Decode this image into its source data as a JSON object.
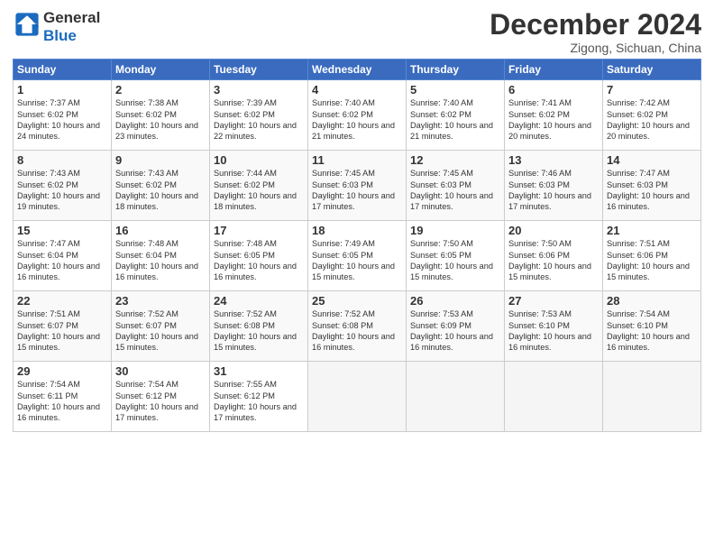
{
  "header": {
    "logo_general": "General",
    "logo_blue": "Blue",
    "month_title": "December 2024",
    "location": "Zigong, Sichuan, China"
  },
  "columns": [
    "Sunday",
    "Monday",
    "Tuesday",
    "Wednesday",
    "Thursday",
    "Friday",
    "Saturday"
  ],
  "weeks": [
    [
      {
        "day": "1",
        "sunrise": "Sunrise: 7:37 AM",
        "sunset": "Sunset: 6:02 PM",
        "daylight": "Daylight: 10 hours and 24 minutes."
      },
      {
        "day": "2",
        "sunrise": "Sunrise: 7:38 AM",
        "sunset": "Sunset: 6:02 PM",
        "daylight": "Daylight: 10 hours and 23 minutes."
      },
      {
        "day": "3",
        "sunrise": "Sunrise: 7:39 AM",
        "sunset": "Sunset: 6:02 PM",
        "daylight": "Daylight: 10 hours and 22 minutes."
      },
      {
        "day": "4",
        "sunrise": "Sunrise: 7:40 AM",
        "sunset": "Sunset: 6:02 PM",
        "daylight": "Daylight: 10 hours and 21 minutes."
      },
      {
        "day": "5",
        "sunrise": "Sunrise: 7:40 AM",
        "sunset": "Sunset: 6:02 PM",
        "daylight": "Daylight: 10 hours and 21 minutes."
      },
      {
        "day": "6",
        "sunrise": "Sunrise: 7:41 AM",
        "sunset": "Sunset: 6:02 PM",
        "daylight": "Daylight: 10 hours and 20 minutes."
      },
      {
        "day": "7",
        "sunrise": "Sunrise: 7:42 AM",
        "sunset": "Sunset: 6:02 PM",
        "daylight": "Daylight: 10 hours and 20 minutes."
      }
    ],
    [
      {
        "day": "8",
        "sunrise": "Sunrise: 7:43 AM",
        "sunset": "Sunset: 6:02 PM",
        "daylight": "Daylight: 10 hours and 19 minutes."
      },
      {
        "day": "9",
        "sunrise": "Sunrise: 7:43 AM",
        "sunset": "Sunset: 6:02 PM",
        "daylight": "Daylight: 10 hours and 18 minutes."
      },
      {
        "day": "10",
        "sunrise": "Sunrise: 7:44 AM",
        "sunset": "Sunset: 6:02 PM",
        "daylight": "Daylight: 10 hours and 18 minutes."
      },
      {
        "day": "11",
        "sunrise": "Sunrise: 7:45 AM",
        "sunset": "Sunset: 6:03 PM",
        "daylight": "Daylight: 10 hours and 17 minutes."
      },
      {
        "day": "12",
        "sunrise": "Sunrise: 7:45 AM",
        "sunset": "Sunset: 6:03 PM",
        "daylight": "Daylight: 10 hours and 17 minutes."
      },
      {
        "day": "13",
        "sunrise": "Sunrise: 7:46 AM",
        "sunset": "Sunset: 6:03 PM",
        "daylight": "Daylight: 10 hours and 17 minutes."
      },
      {
        "day": "14",
        "sunrise": "Sunrise: 7:47 AM",
        "sunset": "Sunset: 6:03 PM",
        "daylight": "Daylight: 10 hours and 16 minutes."
      }
    ],
    [
      {
        "day": "15",
        "sunrise": "Sunrise: 7:47 AM",
        "sunset": "Sunset: 6:04 PM",
        "daylight": "Daylight: 10 hours and 16 minutes."
      },
      {
        "day": "16",
        "sunrise": "Sunrise: 7:48 AM",
        "sunset": "Sunset: 6:04 PM",
        "daylight": "Daylight: 10 hours and 16 minutes."
      },
      {
        "day": "17",
        "sunrise": "Sunrise: 7:48 AM",
        "sunset": "Sunset: 6:05 PM",
        "daylight": "Daylight: 10 hours and 16 minutes."
      },
      {
        "day": "18",
        "sunrise": "Sunrise: 7:49 AM",
        "sunset": "Sunset: 6:05 PM",
        "daylight": "Daylight: 10 hours and 15 minutes."
      },
      {
        "day": "19",
        "sunrise": "Sunrise: 7:50 AM",
        "sunset": "Sunset: 6:05 PM",
        "daylight": "Daylight: 10 hours and 15 minutes."
      },
      {
        "day": "20",
        "sunrise": "Sunrise: 7:50 AM",
        "sunset": "Sunset: 6:06 PM",
        "daylight": "Daylight: 10 hours and 15 minutes."
      },
      {
        "day": "21",
        "sunrise": "Sunrise: 7:51 AM",
        "sunset": "Sunset: 6:06 PM",
        "daylight": "Daylight: 10 hours and 15 minutes."
      }
    ],
    [
      {
        "day": "22",
        "sunrise": "Sunrise: 7:51 AM",
        "sunset": "Sunset: 6:07 PM",
        "daylight": "Daylight: 10 hours and 15 minutes."
      },
      {
        "day": "23",
        "sunrise": "Sunrise: 7:52 AM",
        "sunset": "Sunset: 6:07 PM",
        "daylight": "Daylight: 10 hours and 15 minutes."
      },
      {
        "day": "24",
        "sunrise": "Sunrise: 7:52 AM",
        "sunset": "Sunset: 6:08 PM",
        "daylight": "Daylight: 10 hours and 15 minutes."
      },
      {
        "day": "25",
        "sunrise": "Sunrise: 7:52 AM",
        "sunset": "Sunset: 6:08 PM",
        "daylight": "Daylight: 10 hours and 16 minutes."
      },
      {
        "day": "26",
        "sunrise": "Sunrise: 7:53 AM",
        "sunset": "Sunset: 6:09 PM",
        "daylight": "Daylight: 10 hours and 16 minutes."
      },
      {
        "day": "27",
        "sunrise": "Sunrise: 7:53 AM",
        "sunset": "Sunset: 6:10 PM",
        "daylight": "Daylight: 10 hours and 16 minutes."
      },
      {
        "day": "28",
        "sunrise": "Sunrise: 7:54 AM",
        "sunset": "Sunset: 6:10 PM",
        "daylight": "Daylight: 10 hours and 16 minutes."
      }
    ],
    [
      {
        "day": "29",
        "sunrise": "Sunrise: 7:54 AM",
        "sunset": "Sunset: 6:11 PM",
        "daylight": "Daylight: 10 hours and 16 minutes."
      },
      {
        "day": "30",
        "sunrise": "Sunrise: 7:54 AM",
        "sunset": "Sunset: 6:12 PM",
        "daylight": "Daylight: 10 hours and 17 minutes."
      },
      {
        "day": "31",
        "sunrise": "Sunrise: 7:55 AM",
        "sunset": "Sunset: 6:12 PM",
        "daylight": "Daylight: 10 hours and 17 minutes."
      },
      null,
      null,
      null,
      null
    ]
  ]
}
